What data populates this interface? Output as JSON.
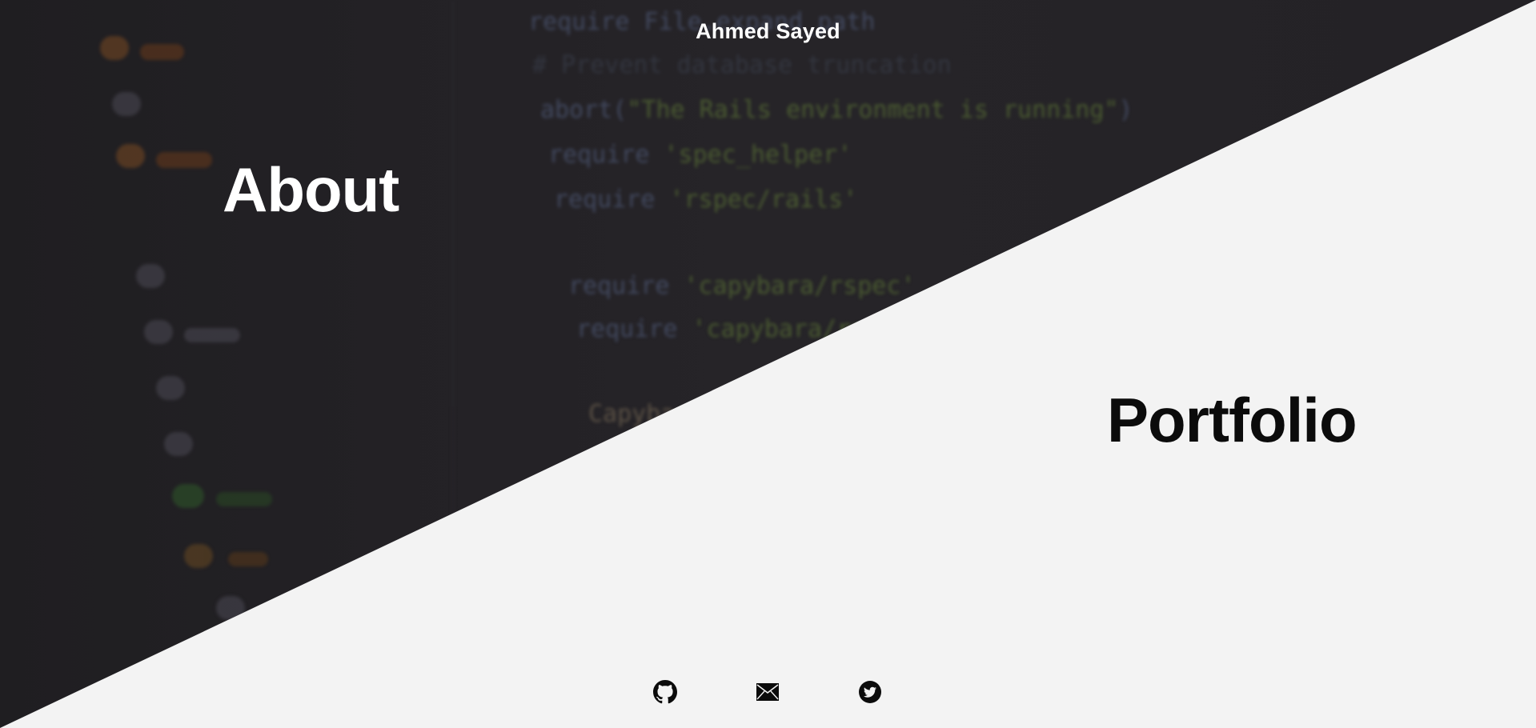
{
  "header": {
    "title": "Ahmed Sayed"
  },
  "nav": {
    "about_label": "About",
    "portfolio_label": "Portfolio"
  },
  "social": [
    {
      "icon": "github-icon"
    },
    {
      "icon": "mail-icon"
    },
    {
      "icon": "twitter-icon"
    }
  ],
  "colors": {
    "dark_panel": "#232125",
    "light_panel": "#f3f3f3",
    "dark_text": "#0b0b0b",
    "light_text": "#ffffff"
  }
}
